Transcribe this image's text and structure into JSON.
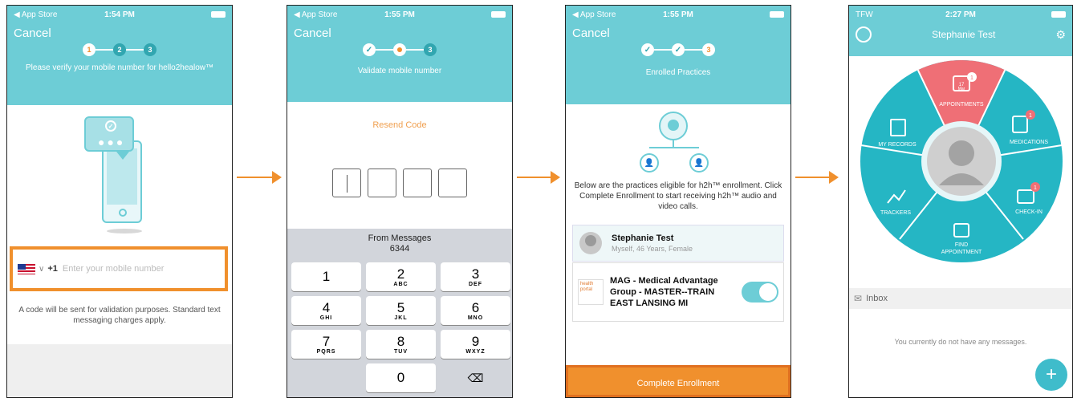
{
  "colors": {
    "teal": "#6dcdd6",
    "orange": "#f0902d",
    "pink": "#ef6f76",
    "ring": "#25b6c4"
  },
  "screen1": {
    "status_left": "◀ App Store",
    "time": "1:54 PM",
    "cancel": "Cancel",
    "steps": [
      "1",
      "2",
      "3"
    ],
    "header": "Please verify your mobile number for hello2healow™",
    "country_code": "+1",
    "phone_placeholder": "Enter your mobile number",
    "note": "A code will be sent for validation purposes. Standard text messaging charges apply."
  },
  "screen2": {
    "status_left": "◀ App Store",
    "time": "1:55 PM",
    "cancel": "Cancel",
    "step3": "3",
    "header": "Validate mobile number",
    "resend": "Resend Code",
    "suggest_title": "From Messages",
    "suggest_code": "6344",
    "keys": [
      {
        "num": "1",
        "let": ""
      },
      {
        "num": "2",
        "let": "ABC"
      },
      {
        "num": "3",
        "let": "DEF"
      },
      {
        "num": "4",
        "let": "GHI"
      },
      {
        "num": "5",
        "let": "JKL"
      },
      {
        "num": "6",
        "let": "MNO"
      },
      {
        "num": "7",
        "let": "PQRS"
      },
      {
        "num": "8",
        "let": "TUV"
      },
      {
        "num": "9",
        "let": "WXYZ"
      }
    ],
    "zero": "0"
  },
  "screen3": {
    "status_left": "◀ App Store",
    "time": "1:55 PM",
    "cancel": "Cancel",
    "step3": "3",
    "header": "Enrolled Practices",
    "description": "Below are the practices eligible for h2h™ enrollment. Click Complete Enrollment to start receiving h2h™ audio and video calls.",
    "patient_name": "Stephanie Test",
    "patient_sub": "Myself, 46 Years, Female",
    "practice_name": "MAG - Medical Advantage Group - MASTER--TRAIN EAST LANSING MI",
    "logo_line1": "health",
    "logo_line2": "portal",
    "complete": "Complete Enrollment"
  },
  "screen4": {
    "status_left": "TFW",
    "time": "2:27 PM",
    "title": "Stephanie Test",
    "cal_day": "17",
    "cal_month": "Mar",
    "segments": {
      "appointments": "APPOINTMENTS",
      "medications": "MEDICATIONS",
      "checkin": "CHECK-IN",
      "find1": "FIND",
      "find2": "APPOINTMENT",
      "trackers": "TRACKERS",
      "records": "MY RECORDS"
    },
    "badges": {
      "appointments": "1",
      "medications": "1",
      "checkin": "1"
    },
    "inbox": "Inbox",
    "empty": "You currently do not have any messages.",
    "fab": "+"
  }
}
